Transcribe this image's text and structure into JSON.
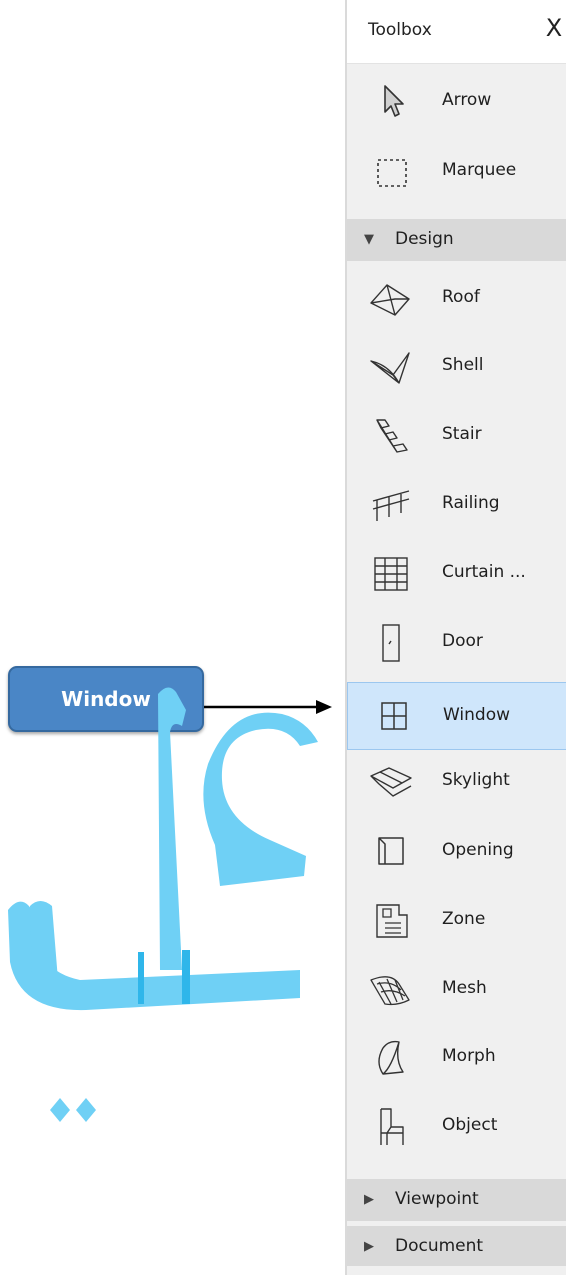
{
  "toolbox": {
    "title": "Toolbox",
    "close_label": "X",
    "basic_tools": [
      {
        "label": "Arrow",
        "icon": "arrow-pointer-icon"
      },
      {
        "label": "Marquee",
        "icon": "marquee-icon"
      }
    ],
    "design_group": {
      "label": "Design",
      "expanded": true
    },
    "design_tools": [
      {
        "label": "Roof",
        "icon": "roof-icon"
      },
      {
        "label": "Shell",
        "icon": "shell-icon"
      },
      {
        "label": "Stair",
        "icon": "stair-icon"
      },
      {
        "label": "Railing",
        "icon": "railing-icon"
      },
      {
        "label": "Curtain ...",
        "icon": "curtain-wall-icon"
      },
      {
        "label": "Door",
        "icon": "door-icon"
      },
      {
        "label": "Window",
        "icon": "window-icon",
        "selected": true
      },
      {
        "label": "Skylight",
        "icon": "skylight-icon"
      },
      {
        "label": "Opening",
        "icon": "opening-icon"
      },
      {
        "label": "Zone",
        "icon": "zone-icon"
      },
      {
        "label": "Mesh",
        "icon": "mesh-icon"
      },
      {
        "label": "Morph",
        "icon": "morph-icon"
      },
      {
        "label": "Object",
        "icon": "object-chair-icon"
      }
    ],
    "collapsed_groups": [
      {
        "label": "Viewpoint",
        "expanded": false
      },
      {
        "label": "Document",
        "expanded": false
      }
    ]
  },
  "callout": {
    "label": "Window",
    "color": "#4a86c6"
  },
  "watermark": {
    "text": "علي",
    "color": "#6fd0f5"
  },
  "colors": {
    "panel_bg": "#f0f0f0",
    "group_bg": "#d9d9d9",
    "selected_bg": "#cfe6fb"
  }
}
